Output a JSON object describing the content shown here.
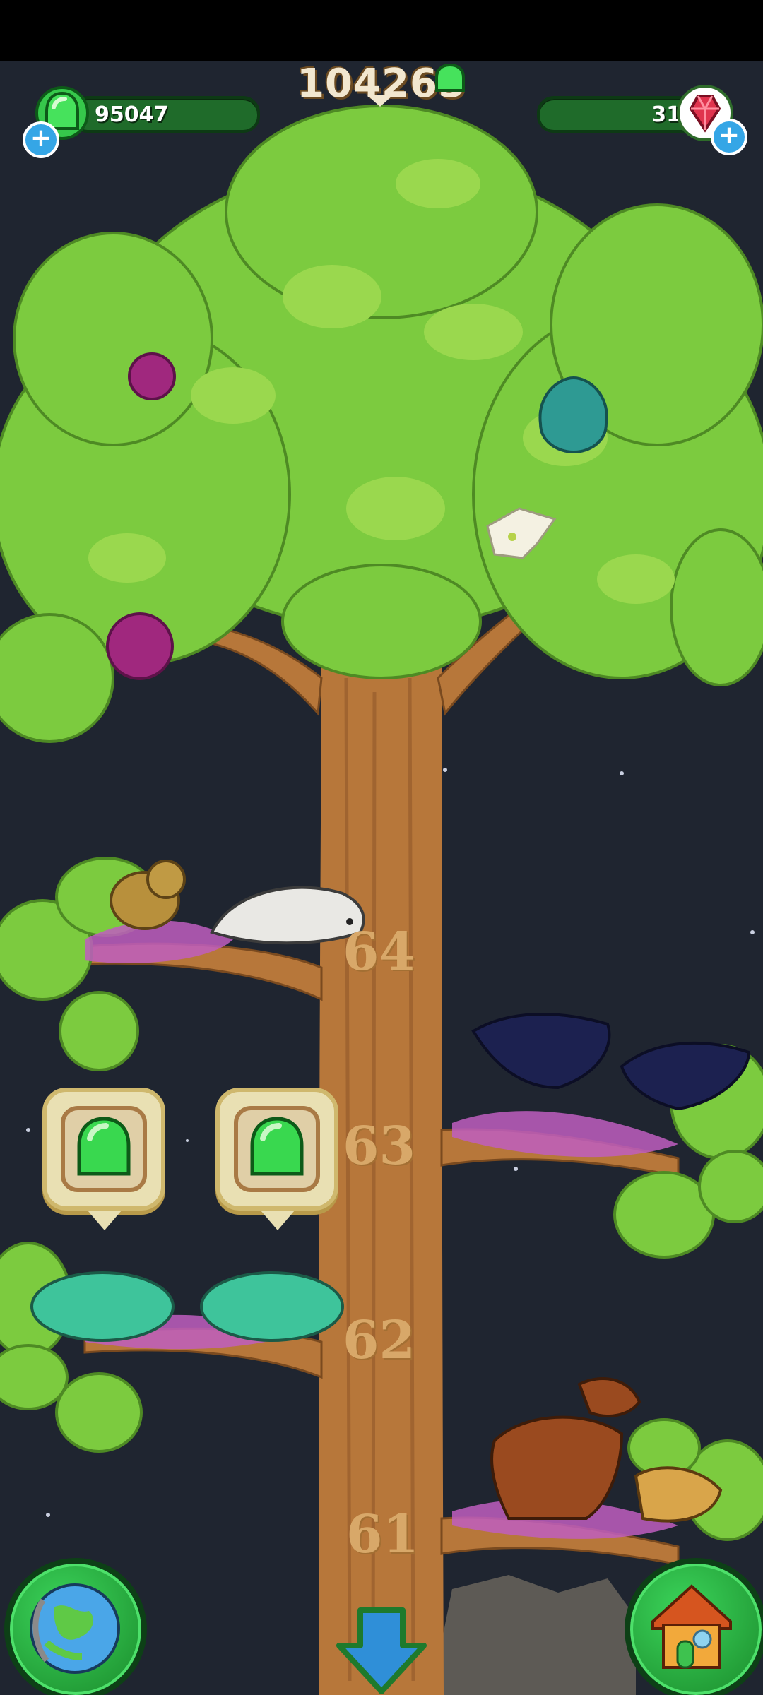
{
  "hud": {
    "gems": "95047",
    "score": "104265",
    "rubies": "31"
  },
  "levels": [
    "64",
    "63",
    "62",
    "61"
  ],
  "rewards": [
    {
      "id": "reward-1",
      "type": "green-gem"
    },
    {
      "id": "reward-2",
      "type": "green-gem"
    }
  ],
  "buttons": {
    "world": "globe-icon",
    "scroll_down": "down-arrow-icon",
    "home": "house-icon"
  },
  "colors": {
    "gem_green": "#39d84f",
    "ruby_red": "#e0344e",
    "trunk": "#bb7a3c",
    "leaf": "#7ccb3f",
    "sky": "#1f2530"
  }
}
